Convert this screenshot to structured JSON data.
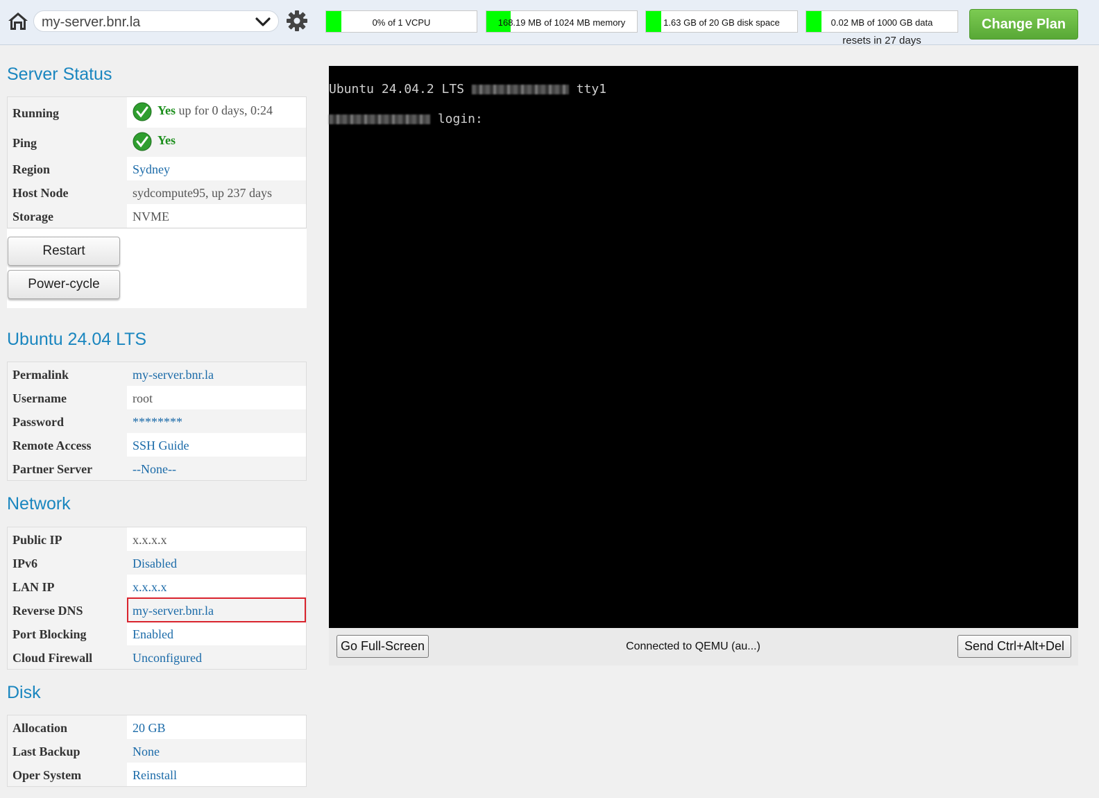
{
  "header": {
    "server_name": "my-server.bnr.la",
    "meters": [
      {
        "label": "0% of 1 VCPU",
        "level": 0.0
      },
      {
        "label": "168.19 MB of 1024 MB memory",
        "level": 0.16
      },
      {
        "label": "1.63 GB of 20 GB disk space",
        "level": 0.08
      },
      {
        "label": "0.02 MB of 1000 GB data",
        "level": 0.0
      }
    ],
    "resets": "resets in 27 days",
    "change_plan": "Change Plan"
  },
  "server_status": {
    "title": "Server Status",
    "running_key": "Running",
    "running_yes": "Yes",
    "running_up": " up for 0 days, 0:24",
    "ping_key": "Ping",
    "ping_yes": "Yes",
    "rows": [
      {
        "key": "Region",
        "value": "Sydney"
      },
      {
        "key": "Host Node",
        "value": "sydcompute95, up 237 days"
      },
      {
        "key": "Storage",
        "value": "NVME"
      }
    ],
    "restart": "Restart",
    "power_cycle": "Power-cycle"
  },
  "os": {
    "title": "Ubuntu 24.04 LTS",
    "rows": [
      {
        "key": "Permalink",
        "value": "my-server.bnr.la"
      },
      {
        "key": "Username",
        "value": "root"
      },
      {
        "key": "Password",
        "value": "********"
      },
      {
        "key": "Remote Access",
        "value": "SSH Guide"
      },
      {
        "key": "Partner Server",
        "value": "--None--"
      }
    ]
  },
  "network": {
    "title": "Network",
    "rows": [
      {
        "key": "Public IP",
        "value": "x.x.x.x"
      },
      {
        "key": "IPv6",
        "value": "Disabled"
      },
      {
        "key": "LAN IP",
        "value": "x.x.x.x"
      },
      {
        "key": "Reverse DNS",
        "value": "my-server.bnr.la"
      },
      {
        "key": "Port Blocking",
        "value": "Enabled"
      },
      {
        "key": "Cloud Firewall",
        "value": "Unconfigured"
      }
    ]
  },
  "disk": {
    "title": "Disk",
    "rows": [
      {
        "key": "Allocation",
        "value": "20 GB"
      },
      {
        "key": "Last Backup",
        "value": "None"
      },
      {
        "key": "Oper System",
        "value": "Reinstall"
      }
    ]
  },
  "console": {
    "line1_a": "Ubuntu 24.04.2 LTS ",
    "line1_b": " tty1",
    "line2": " login:",
    "fullscreen": "Go Full-Screen",
    "status": "Connected to QEMU (au...)",
    "ctrl_alt_del": "Send Ctrl+Alt+Del"
  },
  "colors": {
    "accent": "#1a86bf",
    "meter_fill": "#00ff00",
    "plan_button": "#5fb33c",
    "highlight": "#d9232d"
  }
}
